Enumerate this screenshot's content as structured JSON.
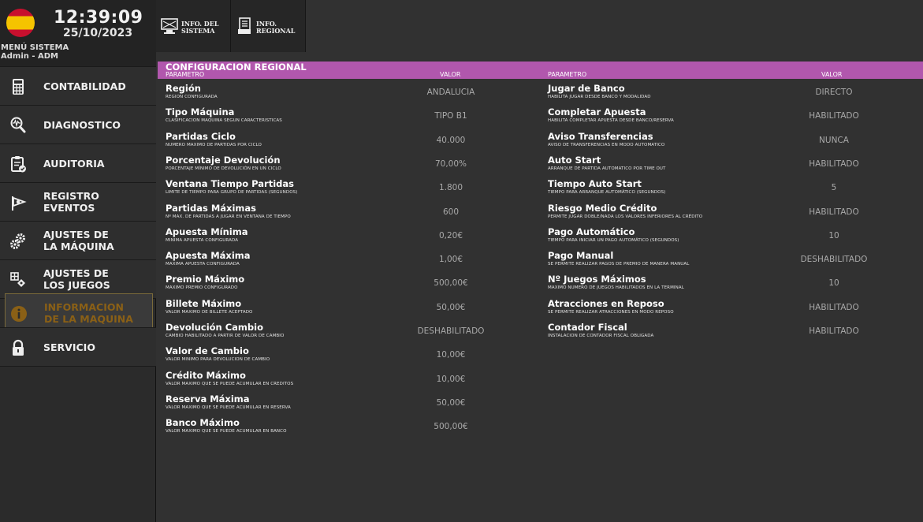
{
  "header": {
    "time": "12:39:09",
    "date": "25/10/2023",
    "menu_title": "MENÚ SISTEMA",
    "user": "Admin - ADM"
  },
  "sidebar": {
    "items": [
      {
        "label": "CONTABILIDAD",
        "icon": "calculator-icon"
      },
      {
        "label": "DIAGNOSTICO",
        "icon": "magnifier-wave-icon"
      },
      {
        "label": "AUDITORIA",
        "icon": "clipboard-check-icon"
      },
      {
        "label": "REGISTRO\nEVENTOS",
        "icon": "flag-log-icon"
      },
      {
        "label": "AJUSTES DE\nLA MÁQUINA",
        "icon": "gears-icon"
      },
      {
        "label": "AJUSTES DE\nLOS JUEGOS",
        "icon": "game-settings-icon"
      },
      {
        "label": "INFORMACION\nDE LA MAQUINA",
        "icon": "info-icon",
        "active": true
      },
      {
        "label": "SERVICIO",
        "icon": "lock-icon"
      }
    ]
  },
  "tabs": [
    {
      "label": "INFO. DEL\nSISTEMA",
      "icon": "system-info-icon"
    },
    {
      "label": "INFO.\nREGIONAL",
      "icon": "regional-info-icon"
    }
  ],
  "main": {
    "title": "CONFIGURACION REGIONAL",
    "col_param": "PARAMETRO",
    "col_value": "VALOR",
    "left": [
      {
        "name": "Región",
        "desc": "REGION CONFIGURADA",
        "value": "ANDALUCIA"
      },
      {
        "name": "Tipo Máquina",
        "desc": "CLASIFICACION MAQUINA SEGUN CARACTERISTICAS",
        "value": "TIPO B1"
      },
      {
        "name": "Partidas Ciclo",
        "desc": "NUMERO MAXIMO DE PARTIDAS POR CICLO",
        "value": "40.000"
      },
      {
        "name": "Porcentaje Devolución",
        "desc": "PORCENTAJE MÍNIMO DE DEVOLUCIÓN EN UN CICLO",
        "value": "70,00%"
      },
      {
        "name": "Ventana Tiempo Partidas",
        "desc": "LIMITE DE TIEMPO PARA GRUPO DE PARTIDAS (SEGUNDOS)",
        "value": "1.800"
      },
      {
        "name": "Partidas Máximas",
        "desc": "Nº MAX. DE PARTIDAS A JUGAR EN VENTANA DE TIEMPO",
        "value": "600"
      },
      {
        "name": "Apuesta Mínima",
        "desc": "MINIMA APUESTA CONFIGURADA",
        "value": "0,20€"
      },
      {
        "name": "Apuesta Máxima",
        "desc": "MAXIMA APUESTA CONFIGURADA",
        "value": "1,00€"
      },
      {
        "name": "Premio Máximo",
        "desc": "MAXIMO PREMIO CONFIGURADO",
        "value": "500,00€"
      },
      {
        "name": "Billete Máximo",
        "desc": "VALOR MAXIMO DE BILLETE ACEPTADO",
        "value": "50,00€"
      },
      {
        "name": "Devolución Cambio",
        "desc": "CAMBIO HABILITADO A PARTIR DE VALOR DE CAMBIO",
        "value": "DESHABILITADO"
      },
      {
        "name": "Valor de Cambio",
        "desc": "VALOR MINIMO PARA DEVOLUCION DE CAMBIO",
        "value": "10,00€"
      },
      {
        "name": "Crédito Máximo",
        "desc": "VALOR MAXIMO QUE SE PUEDE ACUMULAR EN CREDITOS",
        "value": "10,00€"
      },
      {
        "name": "Reserva Máxima",
        "desc": "VALOR MAXIMO QUE SE PUEDE ACUMULAR EN RESERVA",
        "value": "50,00€"
      },
      {
        "name": "Banco Máximo",
        "desc": "VALOR MAXIMO QUE SE PUEDE ACUMULAR EN BANCO",
        "value": "500,00€"
      }
    ],
    "right": [
      {
        "name": "Jugar de Banco",
        "desc": "HABILITA JUGAR DESDE BANCO Y MODALIDAD",
        "value": "DIRECTO"
      },
      {
        "name": "Completar Apuesta",
        "desc": "HABILITA COMPLETAR APUESTA DESDE BANCO/RESERVA",
        "value": "HABILITADO"
      },
      {
        "name": "Aviso Transferencias",
        "desc": "AVISO DE TRANSFERENCIAS EN MODO AUTOMATICO",
        "value": "NUNCA"
      },
      {
        "name": "Auto Start",
        "desc": "ARRANQUE DE PARTIDA AUTOMATICO POR TIME OUT",
        "value": "HABILITADO"
      },
      {
        "name": "Tiempo Auto Start",
        "desc": "TIEMPO PARA ARRANQUE AUTOMÁTICO (SEGUNDOS)",
        "value": "5"
      },
      {
        "name": "Riesgo Medio Crédito",
        "desc": "PERMITE JUGAR DOBLE/NADA LOS VALORES INFERIORES AL CRÉDITO",
        "value": "HABILITADO"
      },
      {
        "name": "Pago Automático",
        "desc": "TIEMPO PARA INICIAR UN PAGO AUTOMÁTICO (SEGUNDOS)",
        "value": "10"
      },
      {
        "name": "Pago Manual",
        "desc": "SE PERMITE REALIZAR PAGOS DE PREMIO DE MANERA MANUAL",
        "value": "DESHABILITADO"
      },
      {
        "name": "Nº Juegos Máximos",
        "desc": "MAXIMO NUMERO DE JUEGOS HABILITADOS EN LA TERMINAL",
        "value": "10"
      },
      {
        "name": "Atracciones en Reposo",
        "desc": "SE PERMITE REALIZAR ATRACCIONES EN MODO REPOSO",
        "value": "HABILITADO"
      },
      {
        "name": "Contador Fiscal",
        "desc": "INSTALACION DE CONTADOR FISCAL OBLIGADA",
        "value": "HABILITADO"
      }
    ]
  }
}
